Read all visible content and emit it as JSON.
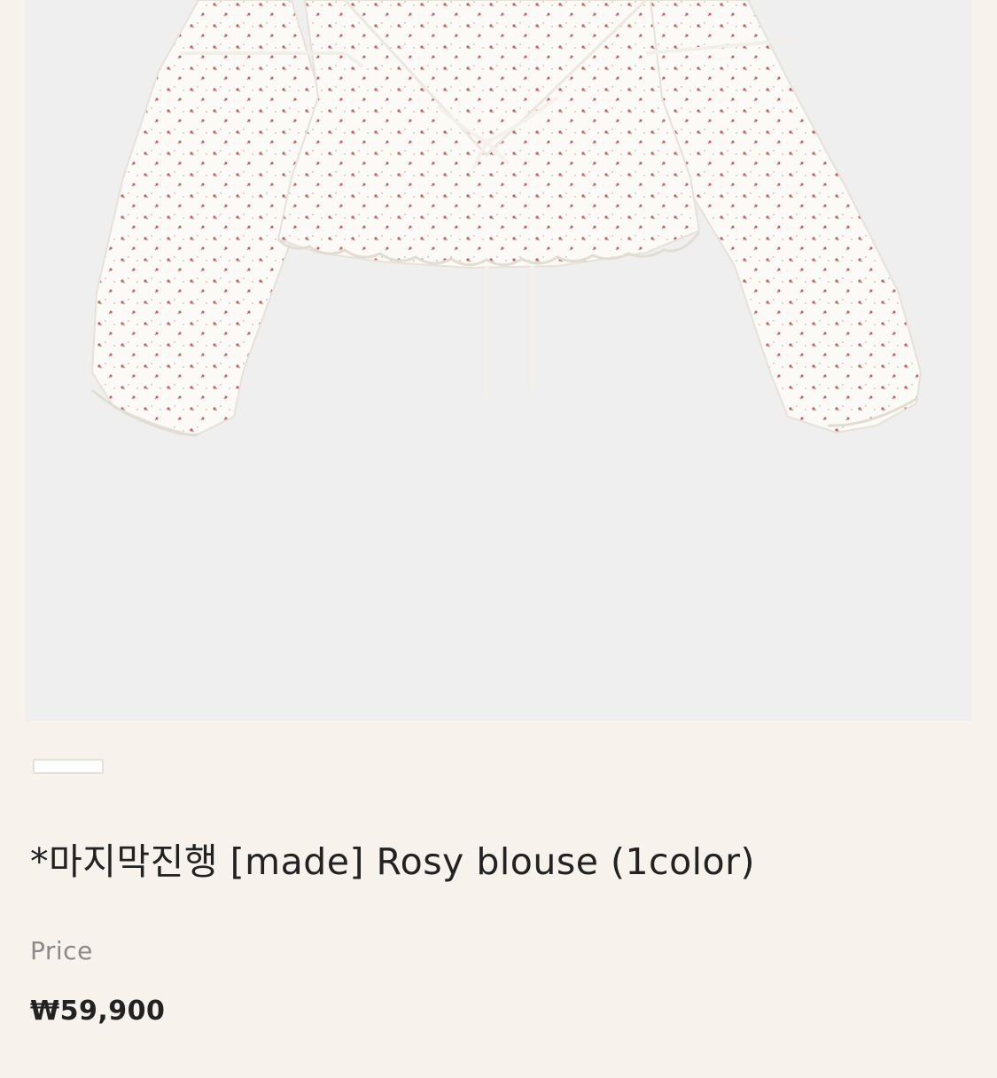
{
  "product": {
    "title": "*마지막진행 [made] Rosy blouse (1color)",
    "price_label": "Price",
    "price": "₩59,900",
    "image": {
      "icon": "blouse-photo",
      "background_color": "#efefef",
      "fabric_color": "#fbfaf7",
      "print_color": "#c95a62"
    }
  },
  "gallery": {
    "indicator": "slide-indicator"
  }
}
